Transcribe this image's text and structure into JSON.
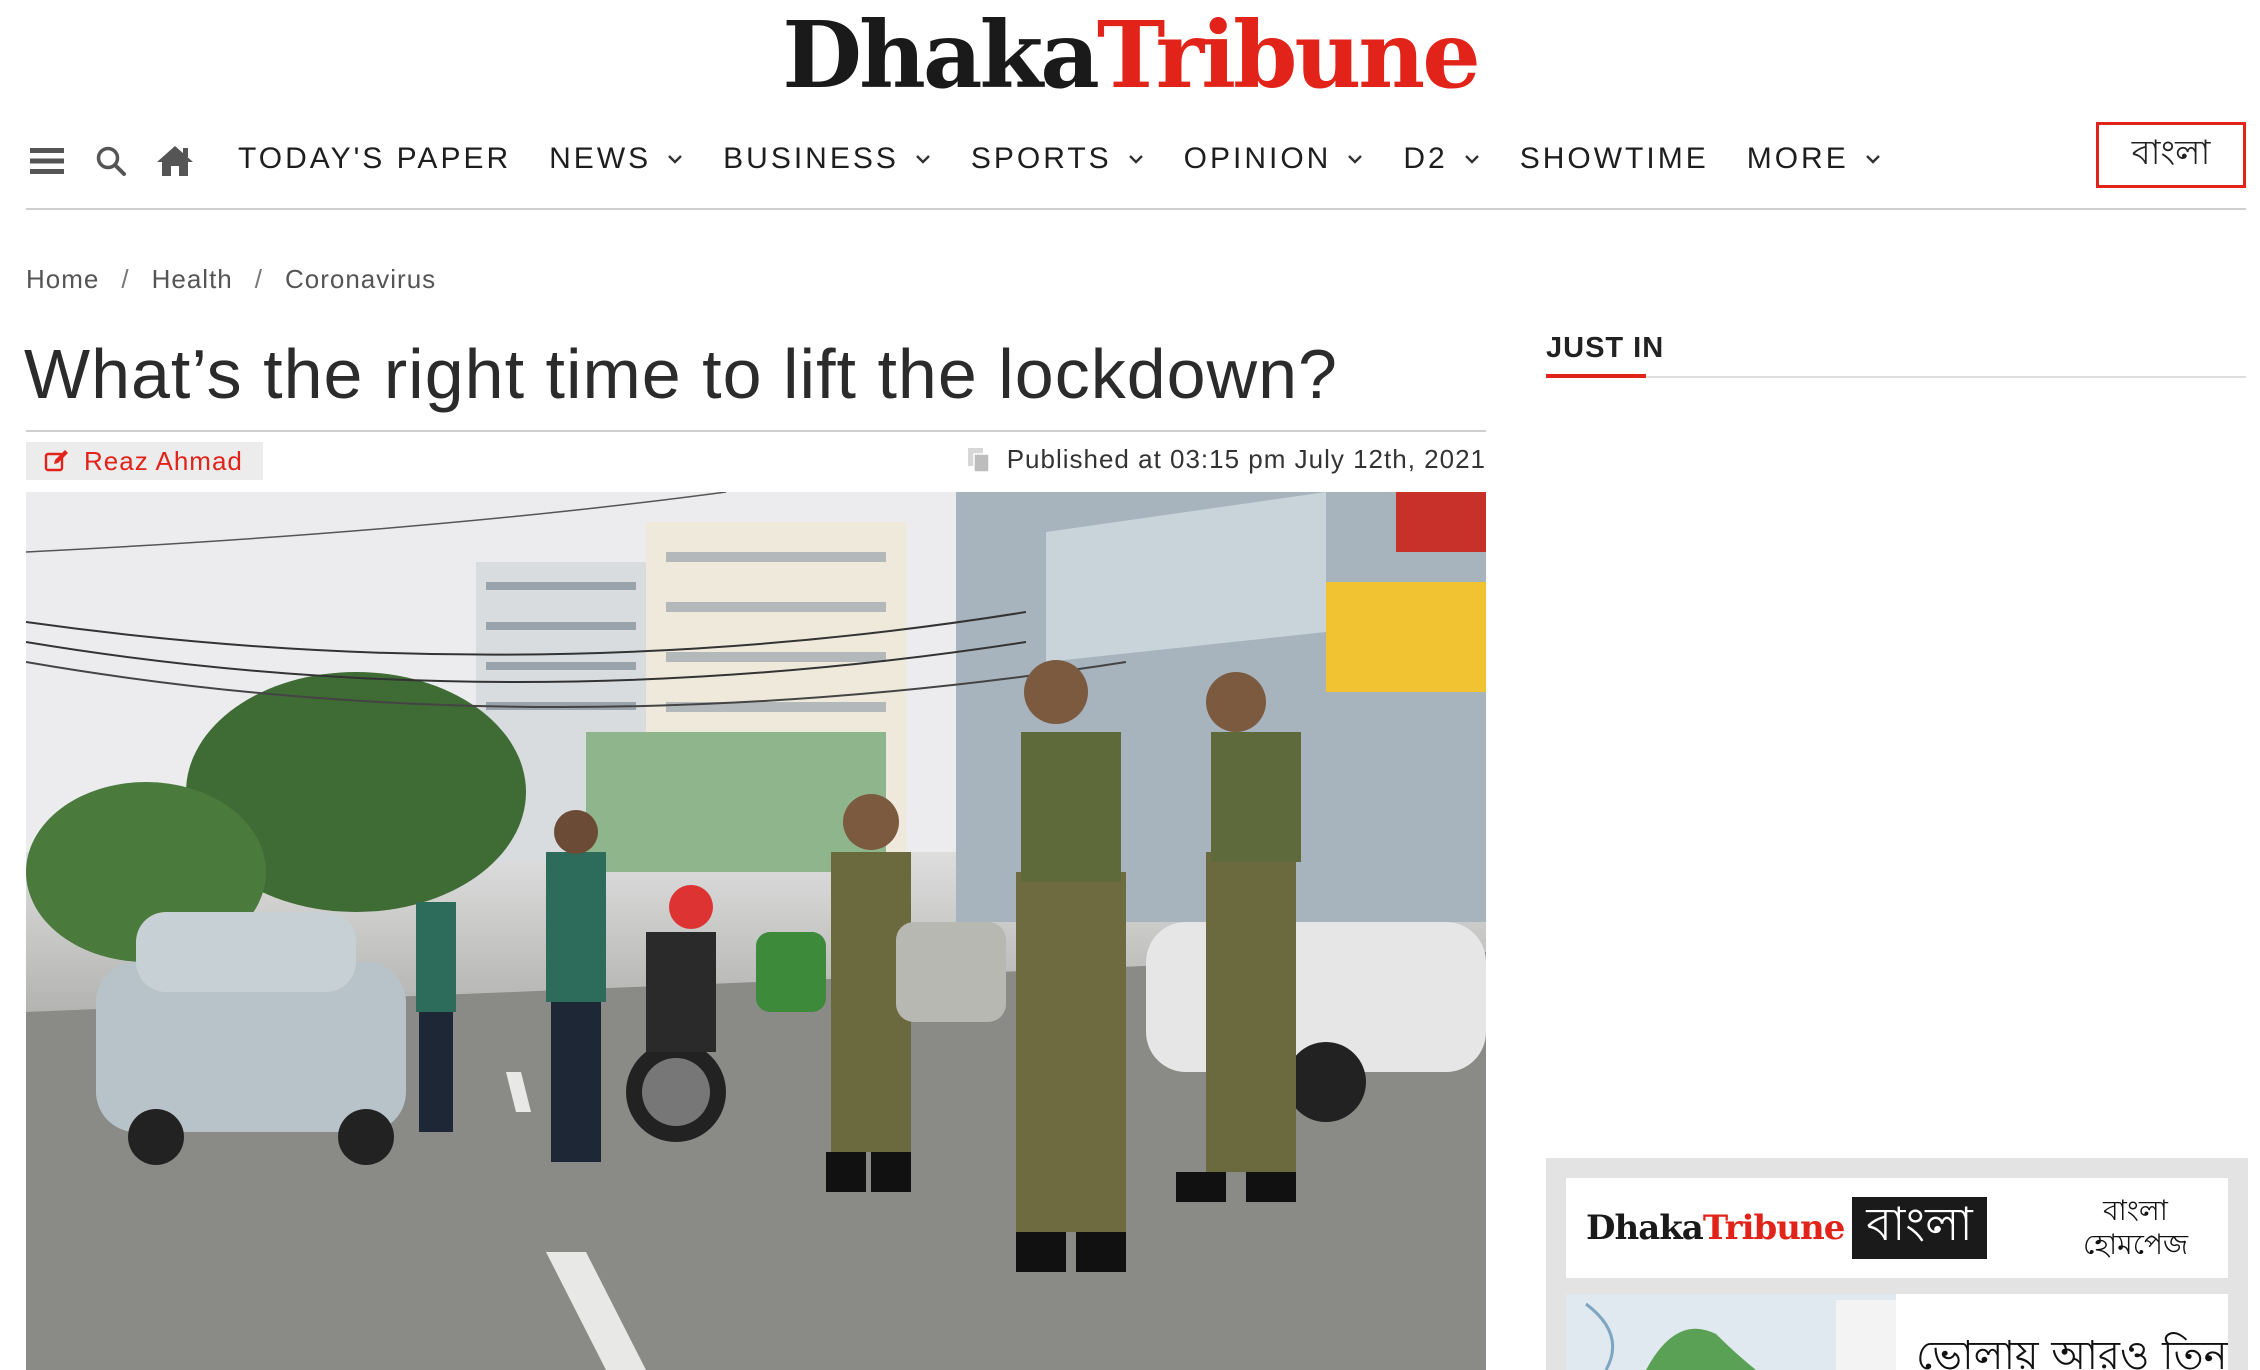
{
  "masthead": {
    "logo_part1": "Dhaka",
    "logo_part2": "Tribune"
  },
  "nav": {
    "icons": [
      "hamburger-icon",
      "search-icon",
      "home-icon"
    ],
    "items": [
      {
        "label": "TODAY'S PAPER",
        "has_dropdown": false
      },
      {
        "label": "NEWS",
        "has_dropdown": true
      },
      {
        "label": "BUSINESS",
        "has_dropdown": true
      },
      {
        "label": "SPORTS",
        "has_dropdown": true
      },
      {
        "label": "OPINION",
        "has_dropdown": true
      },
      {
        "label": "D2",
        "has_dropdown": true
      },
      {
        "label": "SHOWTIME",
        "has_dropdown": false
      },
      {
        "label": "MORE",
        "has_dropdown": true
      }
    ],
    "bangla_button": "বাংলা"
  },
  "breadcrumb": {
    "items": [
      "Home",
      "Health",
      "Coronavirus"
    ],
    "separator": "/"
  },
  "article": {
    "headline": "What’s the right time to lift the lockdown?",
    "author": "Reaz Ahmad",
    "published": "Published at 03:15 pm July 12th, 2021",
    "hero_alt_icons": [
      "edit-icon",
      "copy-icon"
    ]
  },
  "sidebar": {
    "just_in_title": "JUST IN",
    "promo": {
      "logo_part1": "Dhaka",
      "logo_part2": "Tribune",
      "bangla_label": "বাংলা",
      "home_line1": "বাংলা",
      "home_line2": "হোমপেজ",
      "news_headline": "ভোলায় আরও তিনটি"
    }
  },
  "colors": {
    "accent": "#e2231a",
    "text": "#222222",
    "rule": "#cfcfcf",
    "chip_bg": "#ececec"
  }
}
